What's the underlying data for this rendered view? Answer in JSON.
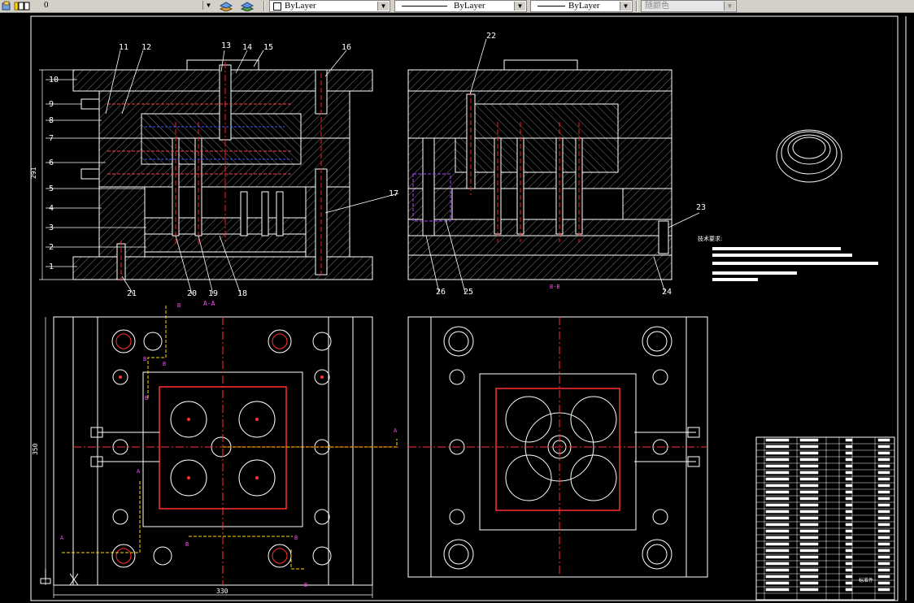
{
  "toolbar": {
    "layer_value": "0",
    "color_value": "ByLayer",
    "linetype_value": "ByLayer",
    "lineweight_value": "ByLayer",
    "plotstyle_value": "随颜色"
  },
  "drawing": {
    "section_view_top_left": {
      "part_numbers": [
        "1",
        "2",
        "3",
        "4",
        "5",
        "6",
        "7",
        "8",
        "9",
        "10",
        "11",
        "12",
        "13",
        "14",
        "15",
        "16",
        "17",
        "18",
        "19",
        "20",
        "21"
      ],
      "dimension_height": "291",
      "view_label": "A-A"
    },
    "section_view_top_right": {
      "part_numbers": [
        "22",
        "23",
        "24",
        "25",
        "26"
      ],
      "view_label": "B-B"
    },
    "plan_view_left": {
      "dimension_width": "330",
      "dimension_height": "350",
      "section_markers": [
        "A",
        "A",
        "B",
        "B",
        "B",
        "B"
      ]
    },
    "tech_requirements_title": "技术要求:",
    "title_block_label": "标准件",
    "bom_rows": 24
  }
}
